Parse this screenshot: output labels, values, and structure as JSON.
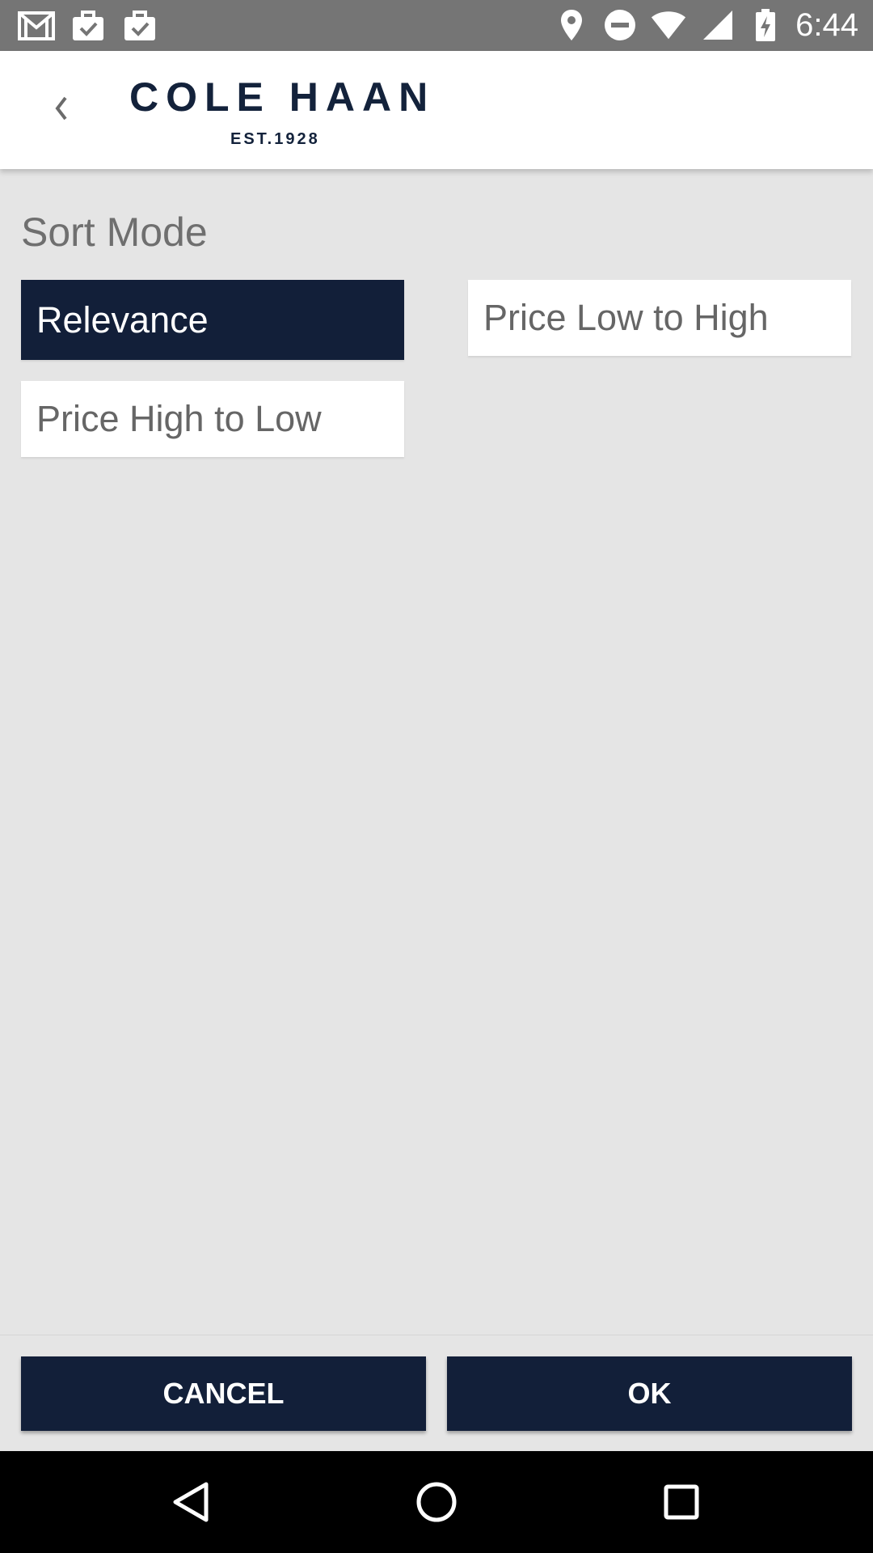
{
  "status_bar": {
    "time": "6:44",
    "left_icons": [
      "gmail-icon",
      "briefcase-check-icon",
      "briefcase-check-icon"
    ],
    "right_icons": [
      "location-icon",
      "do-not-disturb-icon",
      "wifi-icon",
      "signal-icon",
      "battery-charging-icon"
    ]
  },
  "header": {
    "back_icon": "chevron-left-icon",
    "logo_main": "COLE HAAN",
    "logo_sub": "EST.1928"
  },
  "sort": {
    "title": "Sort Mode",
    "options": [
      {
        "label": "Relevance",
        "selected": true
      },
      {
        "label": "Price Low to High",
        "selected": false
      },
      {
        "label": "Price High to Low",
        "selected": false
      }
    ]
  },
  "actions": {
    "cancel_label": "CANCEL",
    "ok_label": "OK"
  },
  "colors": {
    "brand_navy": "#121f39",
    "background": "#e5e5e5",
    "status_bar": "#757575"
  },
  "nav_bar": {
    "icons": [
      "nav-back-icon",
      "nav-home-icon",
      "nav-recents-icon"
    ]
  }
}
